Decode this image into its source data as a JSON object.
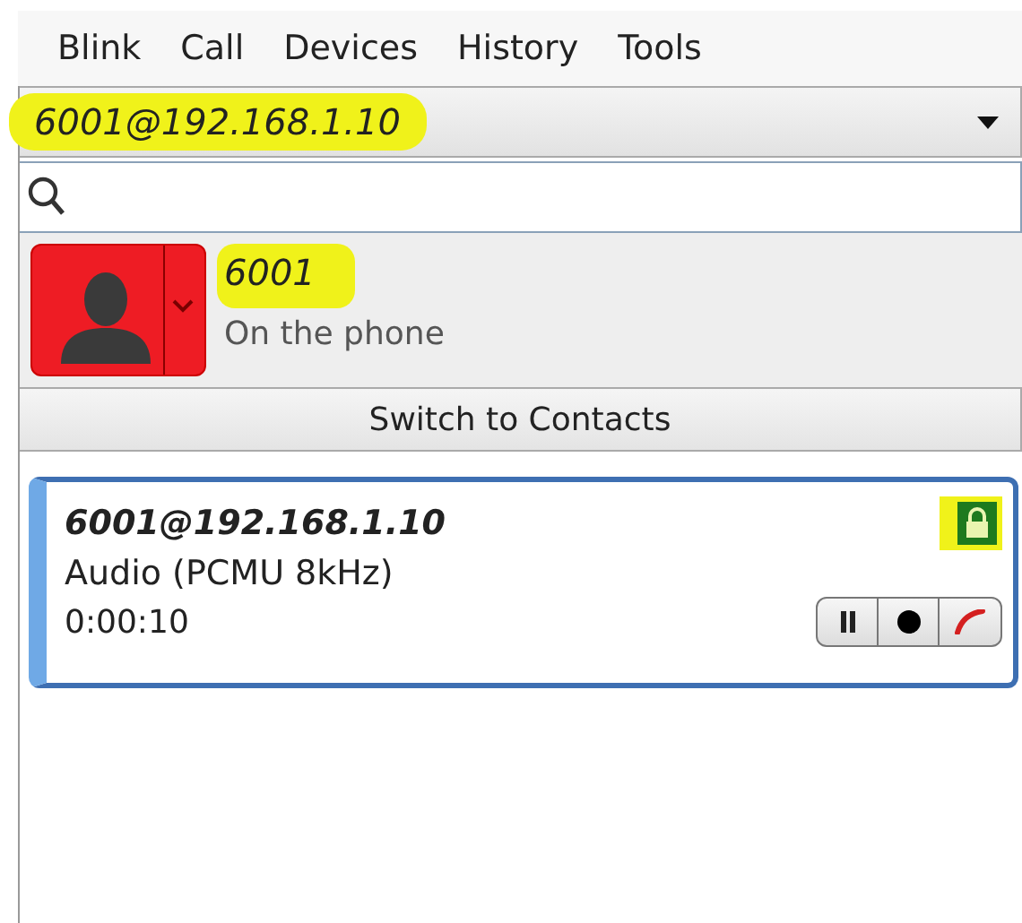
{
  "menu": [
    "Blink",
    "Call",
    "Devices",
    "History",
    "Tools"
  ],
  "account": {
    "value": "6001@192.168.1.10",
    "highlighted": true
  },
  "profile": {
    "name": "6001",
    "name_highlighted": true,
    "status": "On the phone"
  },
  "switch_button": "Switch to Contacts",
  "call": {
    "remote": "6001@192.168.1.10",
    "media": "Audio (PCMU 8kHz)",
    "duration": "0:00:10",
    "encrypted": true,
    "lock_highlighted": true
  }
}
